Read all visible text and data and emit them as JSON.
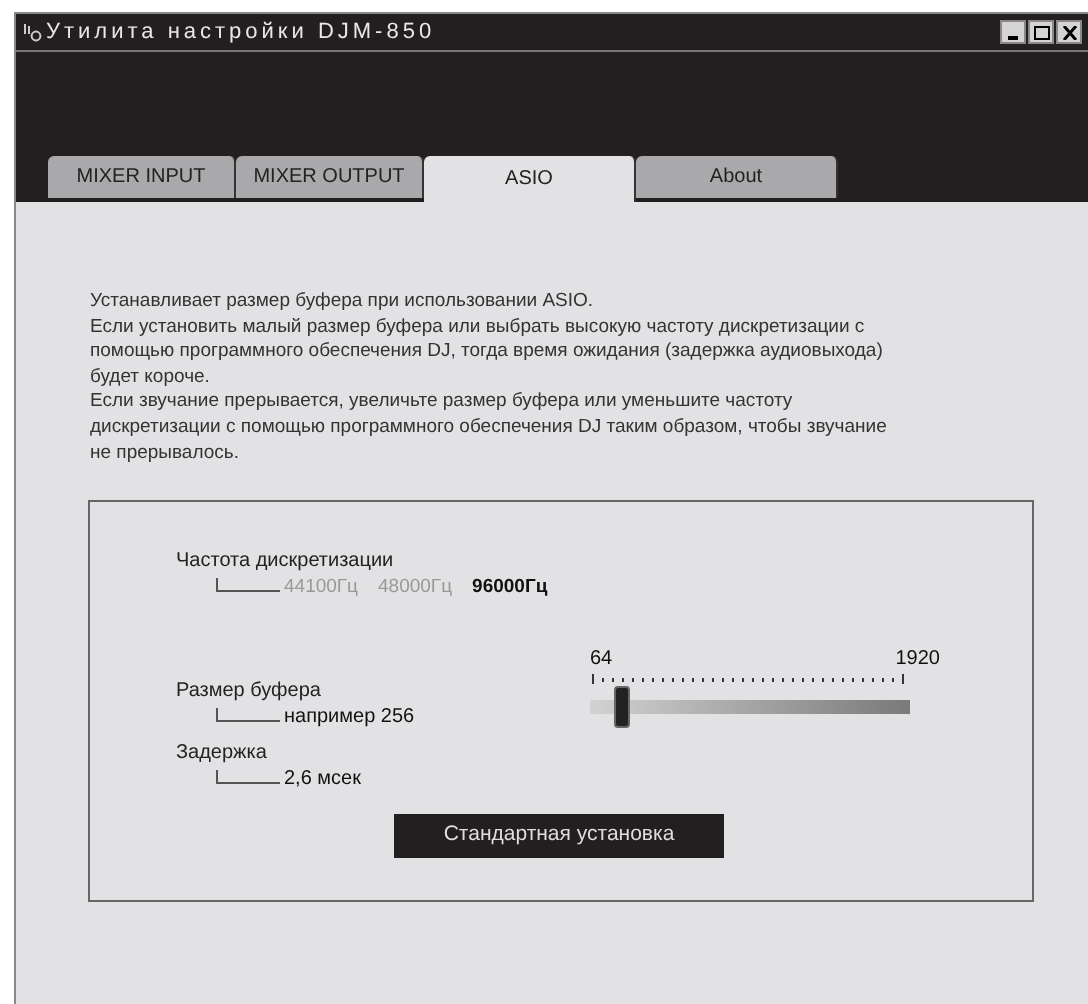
{
  "window": {
    "title": "Утилита настройки DJM-850"
  },
  "tabs": [
    {
      "label": "MIXER INPUT",
      "selected": false
    },
    {
      "label": "MIXER OUTPUT",
      "selected": false
    },
    {
      "label": "ASIO",
      "selected": true
    },
    {
      "label": "About",
      "selected": false
    }
  ],
  "description": [
    "Устанавливает размер буфера при использовании ASIO.",
    "Если установить малый размер буфера или выбрать высокую частоту дискретизации с",
    "помощью программного обеспечения DJ, тогда время ожидания (задержка аудиовыхода)",
    "будет короче.",
    "Если звучание прерывается, увеличьте размер буфера или уменьшите частоту",
    "дискретизации с помощью программного обеспечения DJ таким образом, чтобы звучание",
    "не прерывалось."
  ],
  "sample_rate": {
    "label": "Частота дискретизации",
    "options": [
      {
        "label": "44100Гц",
        "selected": false
      },
      {
        "label": "48000Гц",
        "selected": false
      },
      {
        "label": "96000Гц",
        "selected": true
      }
    ]
  },
  "buffer": {
    "label": "Размер буфера",
    "value": "например 256",
    "min": "64",
    "max": "1920",
    "level": 0.1
  },
  "latency": {
    "label": "Задержка",
    "value": "2,6 мсек"
  },
  "default_button": "Стандартная установка"
}
